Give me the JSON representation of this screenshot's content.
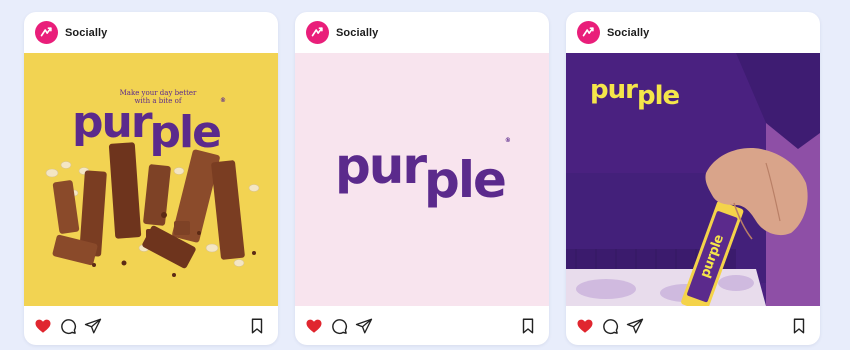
{
  "posts": [
    {
      "account": "Socially",
      "image": {
        "background": "#f2d352",
        "tagline_line1": "Make your day better",
        "tagline_line2": "with a bite of",
        "wordmark_part1": "pur",
        "wordmark_part2": "ple",
        "reg": "®"
      },
      "liked": true
    },
    {
      "account": "Socially",
      "image": {
        "background": "#f8e4ee",
        "wordmark_part1": "pur",
        "wordmark_part2": "ple",
        "reg": "®"
      },
      "liked": true
    },
    {
      "account": "Socially",
      "image": {
        "background": "#4a2180",
        "wordmark_part1": "pur",
        "wordmark_part2": "ple",
        "bar_label": "purple"
      },
      "liked": true
    }
  ],
  "colors": {
    "page_background": "#e8edfb",
    "brand_avatar": "#e91e7a",
    "like_red": "#e0262f",
    "wordmark_purple": "#5b2a8c",
    "wordmark_yellow": "#f5e64a"
  },
  "icons": [
    "heart-icon",
    "comment-icon",
    "share-icon",
    "bookmark-icon"
  ]
}
